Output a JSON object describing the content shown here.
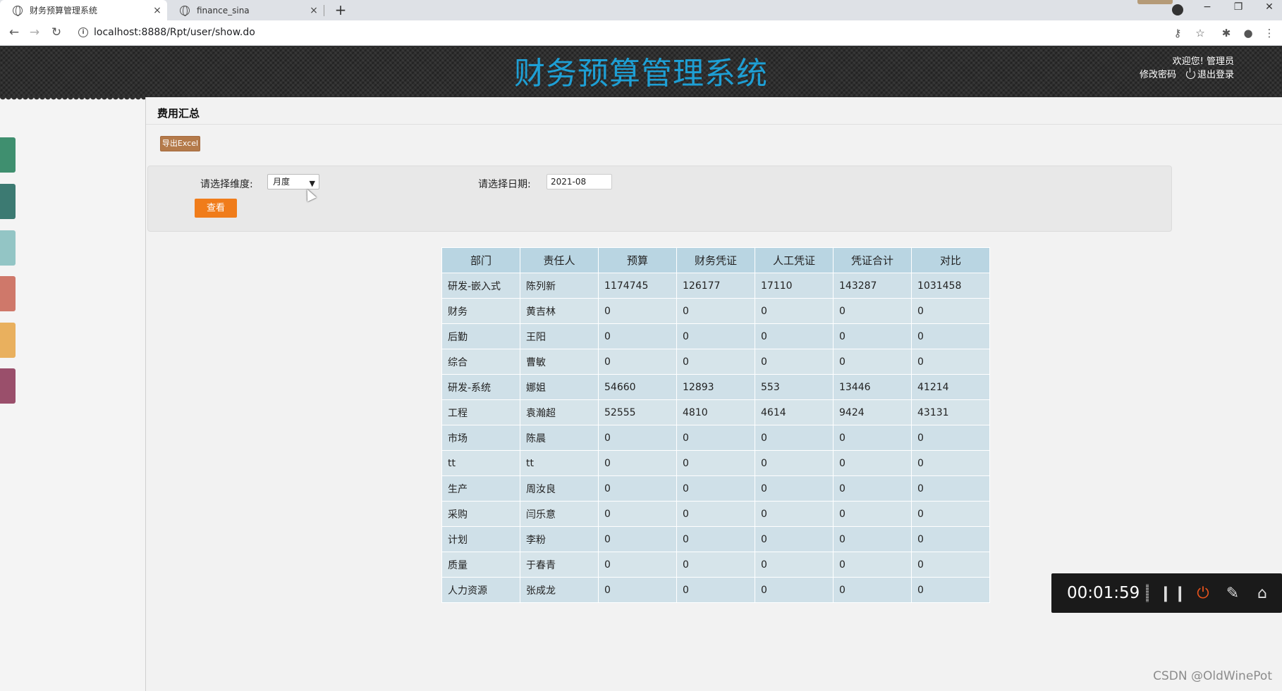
{
  "browser": {
    "tabs": [
      {
        "title": "财务预算管理系统",
        "active": true
      },
      {
        "title": "finance_sina",
        "active": false
      }
    ],
    "new_tab": "+",
    "close_glyph": "×",
    "url": "localhost:8888/Rpt/user/show.do",
    "window_controls": {
      "minimize": "−",
      "restore": "❐",
      "close": "✕"
    }
  },
  "header": {
    "title": "财务预算管理系统",
    "welcome": "欢迎您!",
    "username": "管理员",
    "change_password": "修改密码",
    "logout": "退出登录"
  },
  "sidebar": {
    "colors": [
      "#3f8f6f",
      "#3c7a72",
      "#93c5c5",
      "#cf786a",
      "#e9b05e",
      "#9a4f6b"
    ]
  },
  "page": {
    "title": "费用汇总",
    "export_label": "导出Excel"
  },
  "filter": {
    "dimension_label": "请选择维度:",
    "dimension_value": "月度",
    "date_label": "请选择日期:",
    "date_value": "2021-08",
    "view_label": "查看"
  },
  "table": {
    "headers": [
      "部门",
      "责任人",
      "预算",
      "财务凭证",
      "人工凭证",
      "凭证合计",
      "对比"
    ],
    "rows": [
      [
        "研发-嵌入式",
        "陈列新",
        "1174745",
        "126177",
        "17110",
        "143287",
        "1031458"
      ],
      [
        "财务",
        "黄吉林",
        "0",
        "0",
        "0",
        "0",
        "0"
      ],
      [
        "后勤",
        "王阳",
        "0",
        "0",
        "0",
        "0",
        "0"
      ],
      [
        "综合",
        "曹敏",
        "0",
        "0",
        "0",
        "0",
        "0"
      ],
      [
        "研发-系统",
        "娜姐",
        "54660",
        "12893",
        "553",
        "13446",
        "41214"
      ],
      [
        "工程",
        "袁瀚超",
        "52555",
        "4810",
        "4614",
        "9424",
        "43131"
      ],
      [
        "市场",
        "陈晨",
        "0",
        "0",
        "0",
        "0",
        "0"
      ],
      [
        "tt",
        "tt",
        "0",
        "0",
        "0",
        "0",
        "0"
      ],
      [
        "生产",
        "周汝良",
        "0",
        "0",
        "0",
        "0",
        "0"
      ],
      [
        "采购",
        "闫乐意",
        "0",
        "0",
        "0",
        "0",
        "0"
      ],
      [
        "计划",
        "李粉",
        "0",
        "0",
        "0",
        "0",
        "0"
      ],
      [
        "质量",
        "于春青",
        "0",
        "0",
        "0",
        "0",
        "0"
      ],
      [
        "人力资源",
        "张成龙",
        "0",
        "0",
        "0",
        "0",
        "0"
      ]
    ]
  },
  "recorder": {
    "time": "00:01:59"
  },
  "watermark": "CSDN @OldWinePot"
}
